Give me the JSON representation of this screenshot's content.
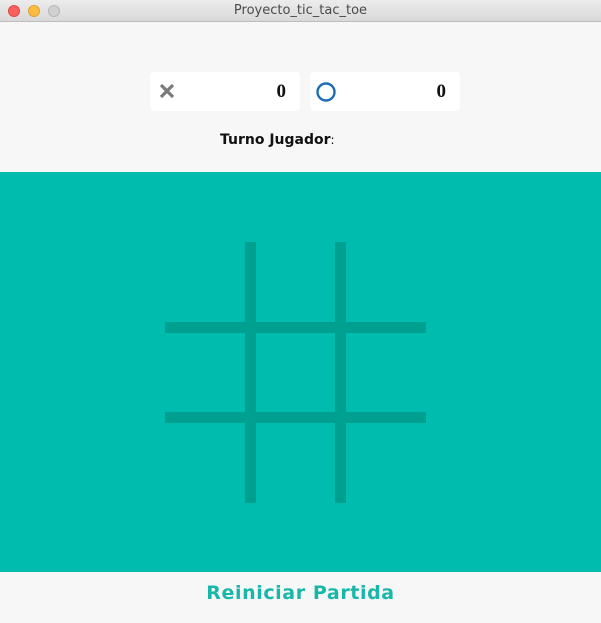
{
  "window": {
    "title": "Proyecto_tic_tac_toe",
    "controls": [
      "close",
      "minimize",
      "maximize"
    ]
  },
  "scoreboard": {
    "player_x": {
      "icon": "x-mark-icon",
      "score": "0"
    },
    "player_o": {
      "icon": "circle-icon",
      "score": "0"
    }
  },
  "turn": {
    "label": "Turno Jugador",
    "separator": ":",
    "current": ""
  },
  "board": {
    "cells": [
      "",
      "",
      "",
      "",
      "",
      "",
      "",
      "",
      ""
    ]
  },
  "footer": {
    "restart_label": "Reiniciar Partida"
  },
  "colors": {
    "board_background": "#00bcaf",
    "grid_lines": "#00a090",
    "accent_text": "#19b7a9",
    "o_icon": "#1f6db5",
    "x_icon": "#7a7a7a"
  }
}
